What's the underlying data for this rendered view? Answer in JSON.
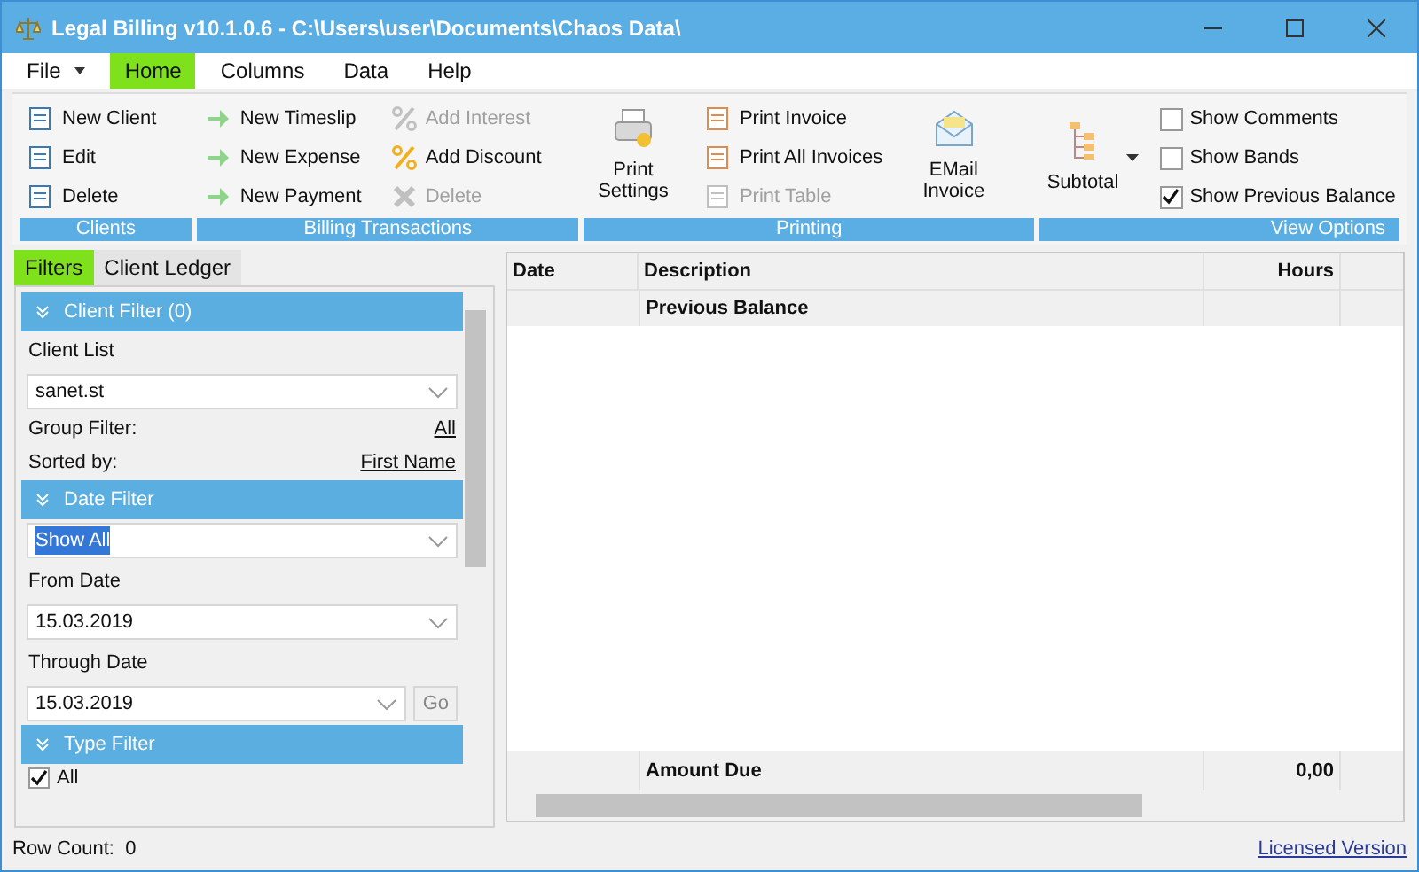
{
  "window": {
    "title": "Legal Billing v10.1.0.6 - C:\\Users\\user\\Documents\\Chaos Data\\"
  },
  "menu": [
    {
      "label": "File",
      "selected": false,
      "dropdown": true
    },
    {
      "label": "Home",
      "selected": true,
      "dropdown": false
    },
    {
      "label": "Columns",
      "selected": false,
      "dropdown": false
    },
    {
      "label": "Data",
      "selected": false,
      "dropdown": false
    },
    {
      "label": "Help",
      "selected": false,
      "dropdown": false
    }
  ],
  "ribbon": [
    {
      "label": "Clients",
      "columns": [
        [
          {
            "kind": "small",
            "label": "New Client",
            "disabled": false
          },
          {
            "kind": "small",
            "label": "Edit",
            "disabled": false
          },
          {
            "kind": "small",
            "label": "Delete",
            "disabled": false
          }
        ]
      ]
    },
    {
      "label": "Billing Transactions",
      "columns": [
        [
          {
            "kind": "small",
            "label": "New Timeslip",
            "disabled": false
          },
          {
            "kind": "small",
            "label": "New Expense",
            "disabled": false
          },
          {
            "kind": "small",
            "label": "New Payment",
            "disabled": false
          }
        ],
        [
          {
            "kind": "small",
            "label": "Add Interest",
            "disabled": true
          },
          {
            "kind": "small",
            "label": "Add Discount",
            "disabled": false
          },
          {
            "kind": "small",
            "label": "Delete",
            "disabled": true
          }
        ]
      ]
    },
    {
      "label": "Printing",
      "columns": [
        [
          {
            "kind": "large",
            "label": "Print Settings",
            "disabled": false
          }
        ],
        [
          {
            "kind": "small",
            "label": "Print Invoice",
            "disabled": false
          },
          {
            "kind": "small",
            "label": "Print All Invoices",
            "disabled": false
          },
          {
            "kind": "small",
            "label": "Print Table",
            "disabled": true
          }
        ],
        [
          {
            "kind": "large",
            "label": "EMail Invoice",
            "disabled": false
          }
        ]
      ]
    },
    {
      "label": "View Options",
      "columns": [
        [
          {
            "kind": "dropdown",
            "label": "Subtotal",
            "disabled": false
          }
        ],
        [
          {
            "kind": "check",
            "label": "Show Comments",
            "checked": false
          },
          {
            "kind": "check",
            "label": "Show Bands",
            "checked": false
          },
          {
            "kind": "check",
            "label": "Show Previous Balance",
            "checked": true
          }
        ]
      ]
    }
  ],
  "panel_tabs": [
    {
      "label": "Filters",
      "selected": true
    },
    {
      "label": "Client Ledger",
      "selected": false
    }
  ],
  "filters": [
    {
      "kind": "header",
      "label": "Client Filter (0)"
    },
    {
      "kind": "label",
      "label": "Client List"
    },
    {
      "kind": "combo",
      "value": "sanet.st",
      "highlighted": false
    },
    {
      "kind": "link",
      "label": "Group Filter:",
      "link": "All"
    },
    {
      "kind": "link",
      "label": "Sorted by:",
      "link": "First Name"
    },
    {
      "kind": "header",
      "label": "Date Filter"
    },
    {
      "kind": "combo",
      "value": "Show All",
      "highlighted": true
    },
    {
      "kind": "label",
      "label": "From Date"
    },
    {
      "kind": "combo",
      "value": "15.03.2019",
      "highlighted": false
    },
    {
      "kind": "label",
      "label": "Through Date"
    },
    {
      "kind": "combo",
      "value": "15.03.2019",
      "highlighted": false,
      "button": "Go"
    },
    {
      "kind": "header",
      "label": "Type Filter"
    },
    {
      "kind": "check",
      "label": "All",
      "checked": true
    }
  ],
  "table": {
    "columns": [
      "Date",
      "Description",
      "Hours"
    ],
    "rows": [
      {
        "date": "",
        "description": "Previous Balance",
        "hours": ""
      }
    ],
    "footer": {
      "label": "Amount Due",
      "value": "0,00"
    }
  },
  "status_bar": {
    "row_count": "Row Count:  0",
    "link": "Licensed Version"
  }
}
